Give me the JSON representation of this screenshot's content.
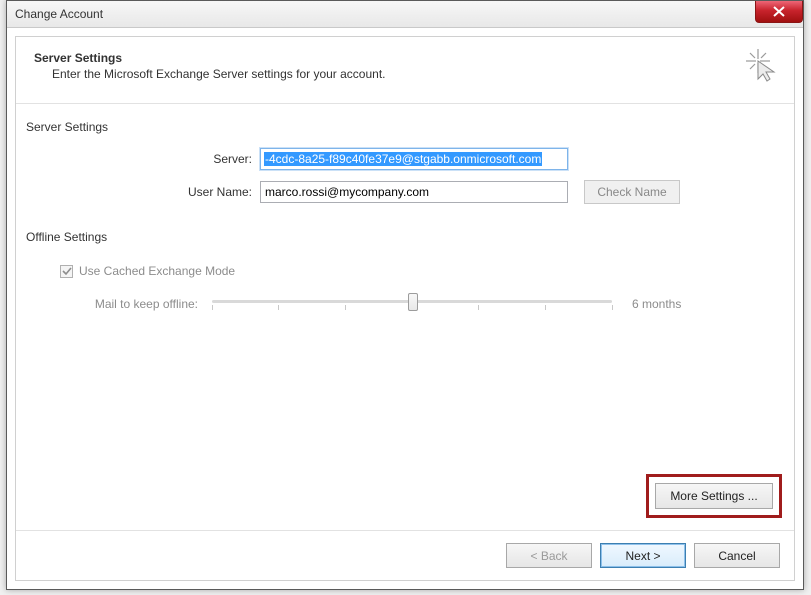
{
  "window": {
    "title": "Change Account"
  },
  "header": {
    "title": "Server Settings",
    "subtitle": "Enter the Microsoft Exchange Server settings for your account."
  },
  "server_settings": {
    "section_label": "Server Settings",
    "server_label": "Server:",
    "server_value": "-4cdc-8a25-f89c40fe37e9@stgabb.onmicrosoft.com",
    "username_label": "User Name:",
    "username_value": "marco.rossi@mycompany.com",
    "check_name_label": "Check Name"
  },
  "offline_settings": {
    "section_label": "Offline Settings",
    "cached_mode_label": "Use Cached Exchange Mode",
    "cached_mode_checked": true,
    "slider_label": "Mail to keep offline:",
    "slider_value_label": "6 months"
  },
  "buttons": {
    "more_settings": "More Settings ...",
    "back": "< Back",
    "next": "Next >",
    "cancel": "Cancel"
  }
}
